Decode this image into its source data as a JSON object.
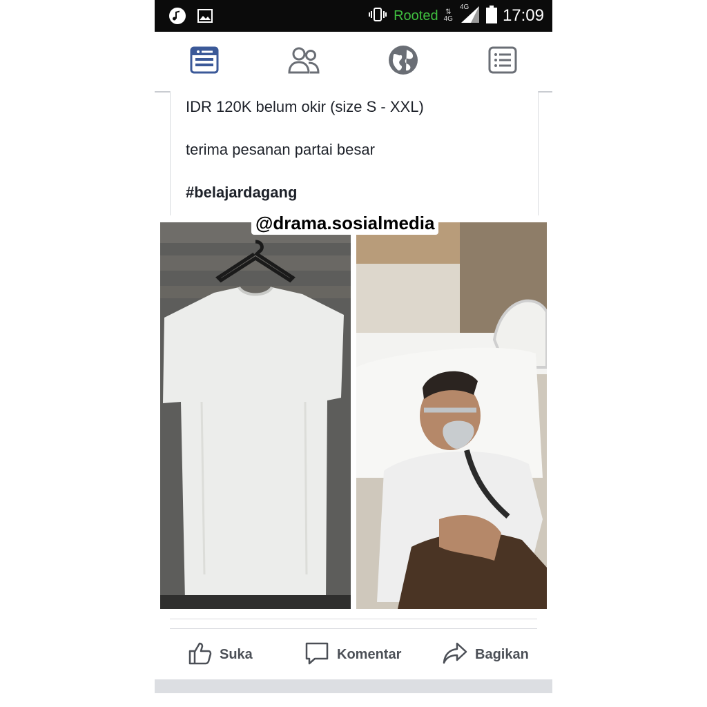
{
  "status_bar": {
    "rooted_label": "Rooted",
    "network_type": "4G",
    "network_sub": "4G",
    "time": "17:09"
  },
  "nav_tabs": [
    {
      "name": "news-feed",
      "icon": "news-feed-icon",
      "active": true
    },
    {
      "name": "friends",
      "icon": "friends-icon",
      "active": false
    },
    {
      "name": "notifications",
      "icon": "globe-icon",
      "active": false
    },
    {
      "name": "menu",
      "icon": "menu-list-icon",
      "active": false
    }
  ],
  "post": {
    "lines": [
      "IDR 120K belum okir (size S - XXL)",
      "terima pesanan partai besar",
      "#belajardagang"
    ],
    "watermark": "@drama.sosialmedia"
  },
  "actions": {
    "like": "Suka",
    "comment": "Komentar",
    "share": "Bagikan"
  },
  "colors": {
    "accent": "#3b5998",
    "status_bar_bg": "#0b0b0b",
    "rooted_green": "#3fbf3f",
    "text": "#1d2129",
    "action_text": "#4b4f56"
  }
}
